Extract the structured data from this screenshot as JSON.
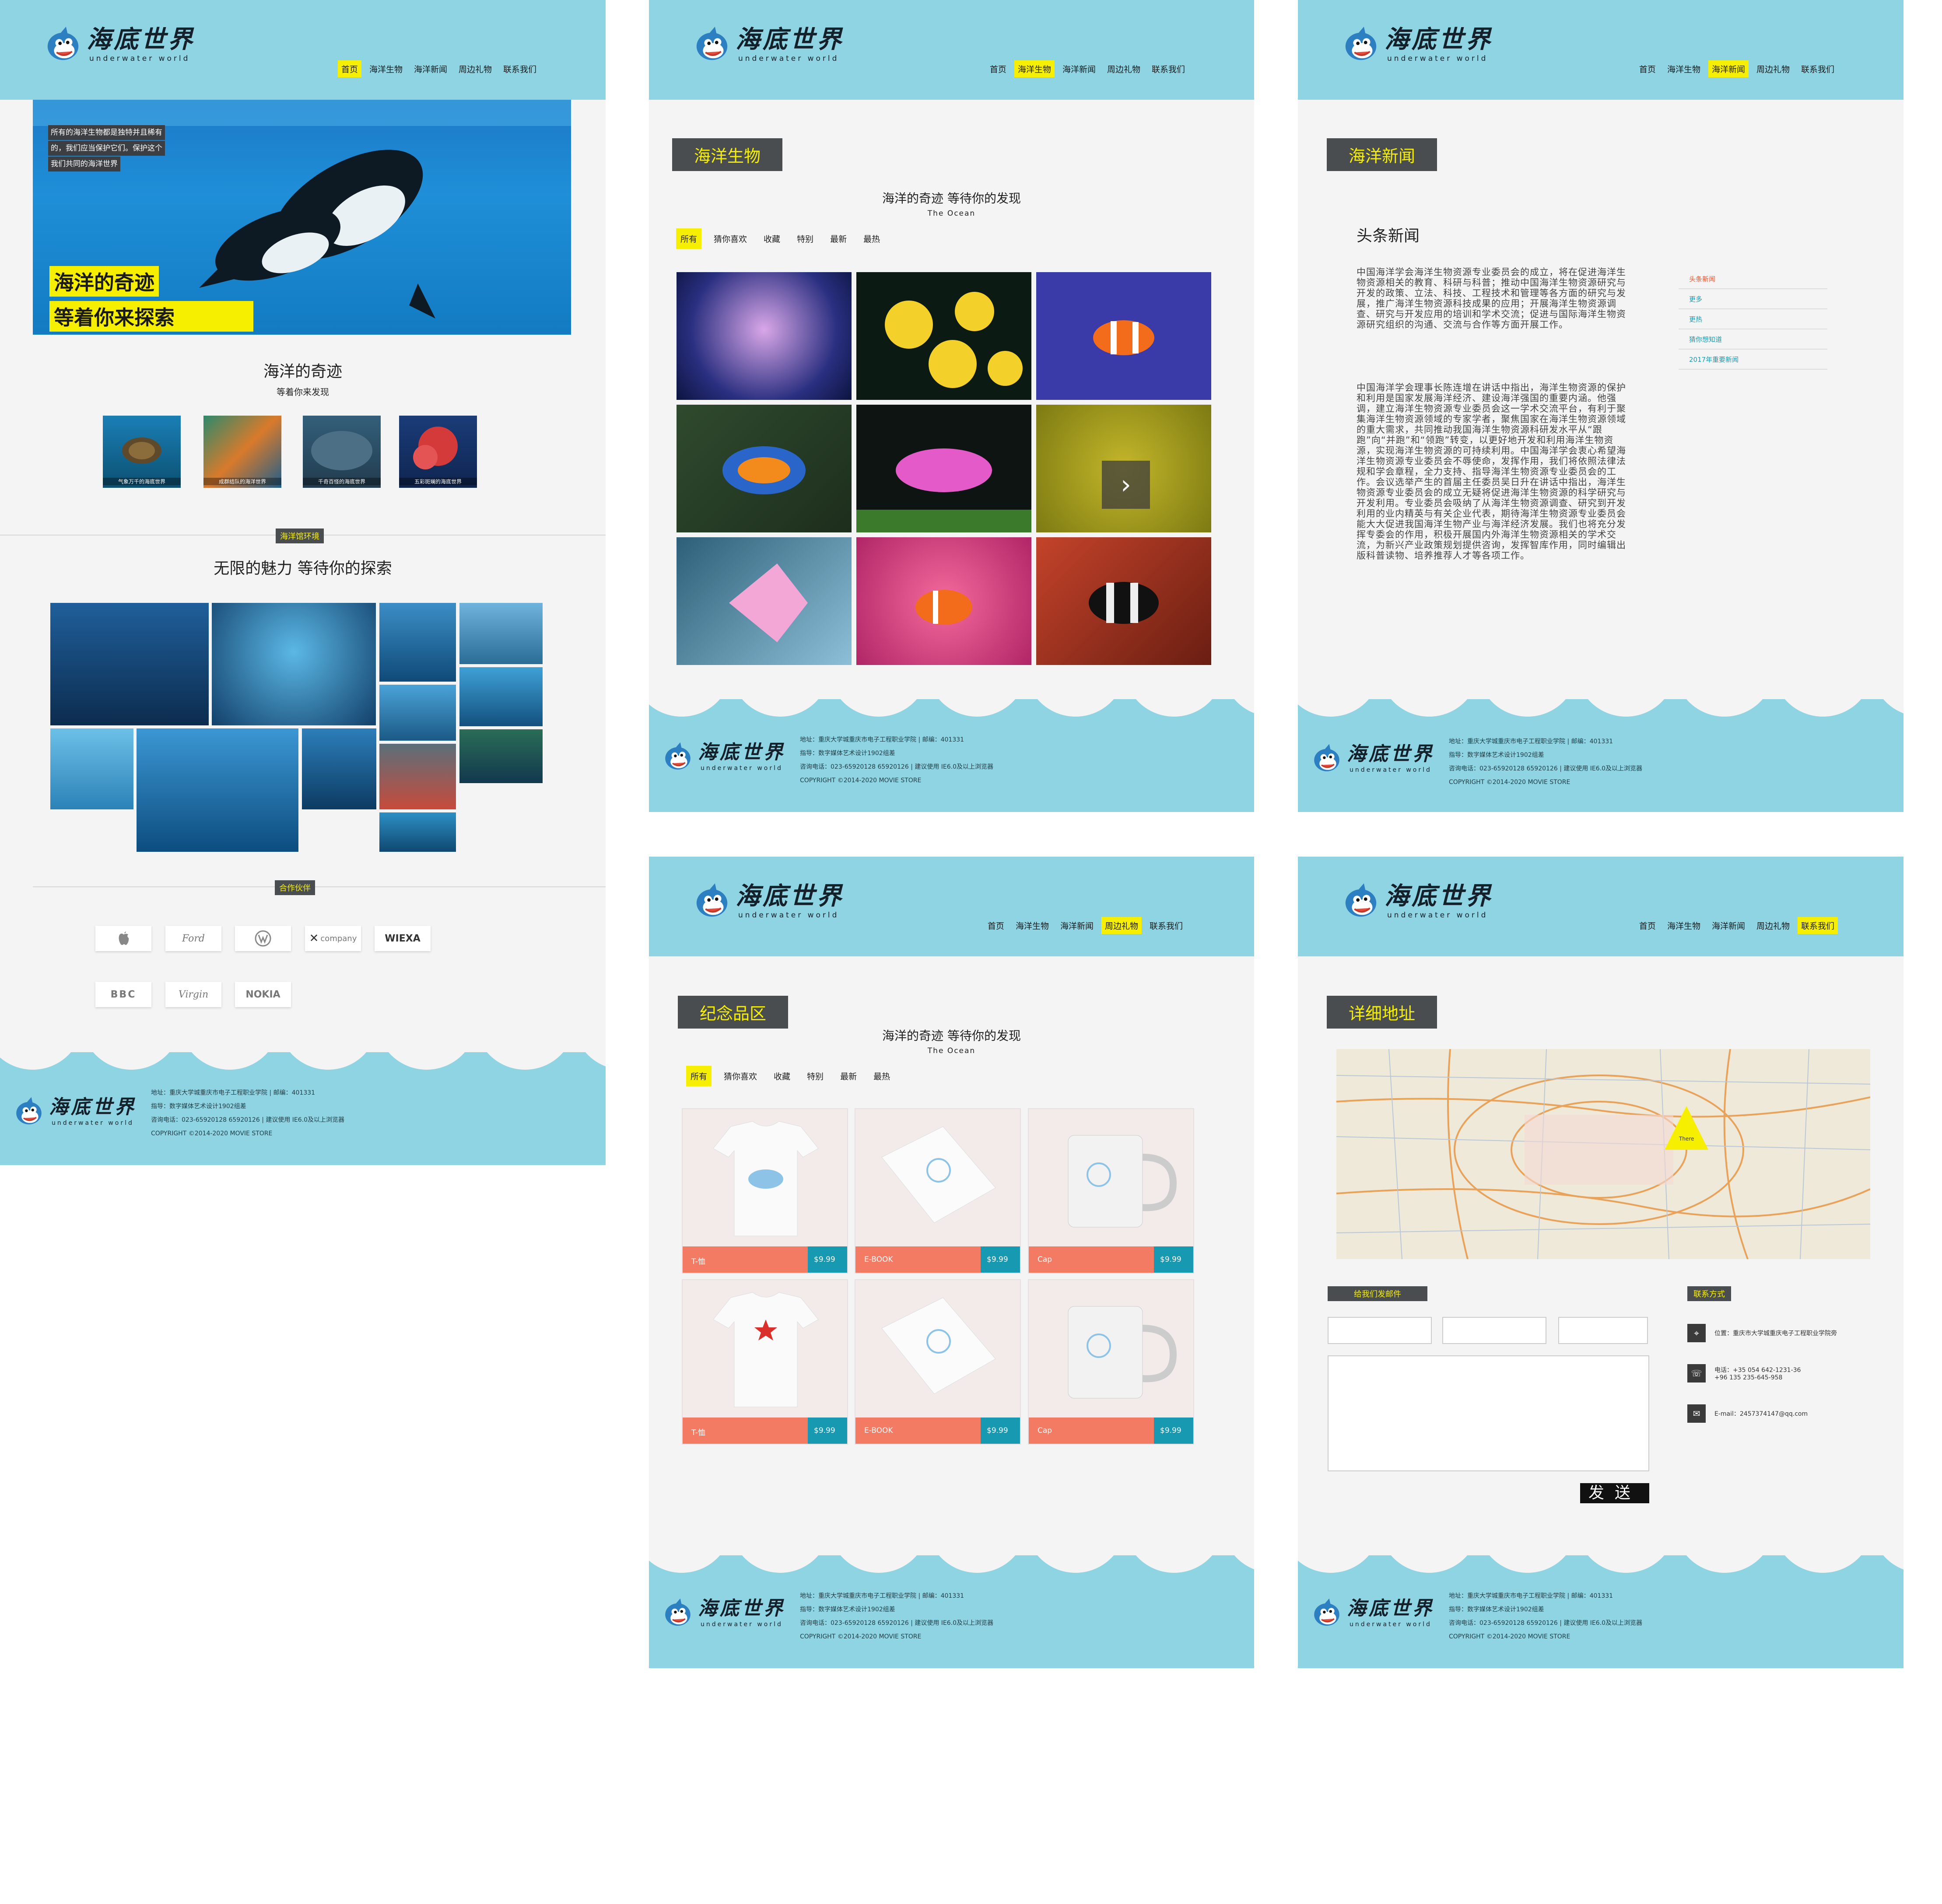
{
  "brand": {
    "name_cn": "海底世界",
    "name_en": "underwater world"
  },
  "nav": [
    "首页",
    "海洋生物",
    "海洋新闻",
    "周边礼物",
    "联系我们"
  ],
  "footer": {
    "line1": "地址：重庆大学城重庆市电子工程职业学院    |    邮编：401331",
    "line2": "指导：数字媒体艺术设计1902组差",
    "line3": "咨询电话：023-65920128 65920126    |    建议使用 IE6.0及以上浏览器",
    "line4": "COPYRIGHT ©2014-2020 MOVIE STORE"
  },
  "home": {
    "hero_note": [
      "所有的海洋生物都是独特并且稀有",
      "的，我们应当保护它们。保护这个",
      "我们共同的海洋世界"
    ],
    "hero_big": [
      "海洋的奇迹",
      "等着你来探索"
    ],
    "section_title": "海洋的奇迹",
    "section_sub": "等着你来发现",
    "thumbs": [
      "气象万千的海底世界",
      "成群结队的海洋世界",
      "千奇百怪的海底世界",
      "五彩斑斓的海底世界"
    ],
    "env_tag": "海洋馆环境",
    "env_title": "无限的魅力  等待你的探索",
    "partner_tag": "合作伙伴",
    "partners": [
      "",
      "Ford",
      "VW",
      "company",
      "WIEXA",
      "BBC",
      "Virgin",
      "NOKIA"
    ]
  },
  "creatures": {
    "tag": "海洋生物",
    "title": "海洋的奇迹  等待你的发现",
    "sub": "The Ocean",
    "filters": [
      "所有",
      "猜你喜欢",
      "收藏",
      "特别",
      "最新",
      "最热"
    ]
  },
  "news": {
    "tag": "海洋新闻",
    "headline": "头条新闻",
    "p1": "中国海洋学会海洋生物资源专业委员会的成立，将在促进海洋生物资源相关的教育、科研与科普；推动中国海洋生物资源研究与开发的政策、立法、科技、工程技术和管理等各方面的研究与发展，推广海洋生物资源科技成果的应用；开展海洋生物资源调查、研究与开发应用的培训和学术交流；促进与国际海洋生物资源研究组织的沟通、交流与合作等方面开展工作。",
    "p2": "中国海洋学会理事长陈连增在讲话中指出，海洋生物资源的保护和利用是国家发展海洋经济、建设海洋强国的重要内涵。他强调，建立海洋生物资源专业委员会这一学术交流平台，有利于聚集海洋生物资源领域的专家学者，聚焦国家在海洋生物资源领域的重大需求，共同推动我国海洋生物资源科研发水平从“跟跑”向“并跑”和“领跑”转变，以更好地开发和利用海洋生物资源，实现海洋生物资源的可持续利用。中国海洋学会衷心希望海洋生物资源专业委员会不辱使命，发挥作用，我们将依照法律法规和学会章程，全力支持、指导海洋生物资源专业委员会的工作。会议选举产生的首届主任委员吴日升在讲话中指出，海洋生物资源专业委员会的成立无疑将促进海洋生物资源的科学研究与开发利用。专业委员会吸纳了从海洋生物资源调查、研究到开发利用的业内精英与有关企业代表，期待海洋生物资源专业委员会能大大促进我国海洋生物产业与海洋经济发展。我们也将充分发挥专委会的作用，积极开展国内外海洋生物资源相关的学术交流，为新兴产业政策规划提供咨询，发挥智库作用，同时编辑出版科普读物、培养推荐人才等各项工作。",
    "side": [
      "头条新闻",
      "更多",
      "更热",
      "猜你想知道",
      "2017年重要新闻"
    ]
  },
  "gifts": {
    "tag": "纪念品区",
    "title": "海洋的奇迹  等待你的发现",
    "sub": "The Ocean",
    "filters": [
      "所有",
      "猜你喜欢",
      "收藏",
      "特别",
      "最新",
      "最热"
    ],
    "products": [
      {
        "name": "T-恤",
        "price": "$9.99"
      },
      {
        "name": "E-BOOK",
        "price": "$9.99"
      },
      {
        "name": "Cap",
        "price": "$9.99"
      },
      {
        "name": "T-恤",
        "price": "$9.99"
      },
      {
        "name": "E-BOOK",
        "price": "$9.99"
      },
      {
        "name": "Cap",
        "price": "$9.99"
      }
    ]
  },
  "contact": {
    "tag": "详细地址",
    "mail_tag": "给我们发邮件",
    "contact_tag": "联系方式",
    "map_pin": "There",
    "address": "位置：重庆市大学城重庆电子工程职业学院旁",
    "phone": "电话：+35 054 642-1231-36\n+96 135 235-645-958",
    "email": "E-mail：2457374147@qq.com",
    "send": "发送"
  }
}
